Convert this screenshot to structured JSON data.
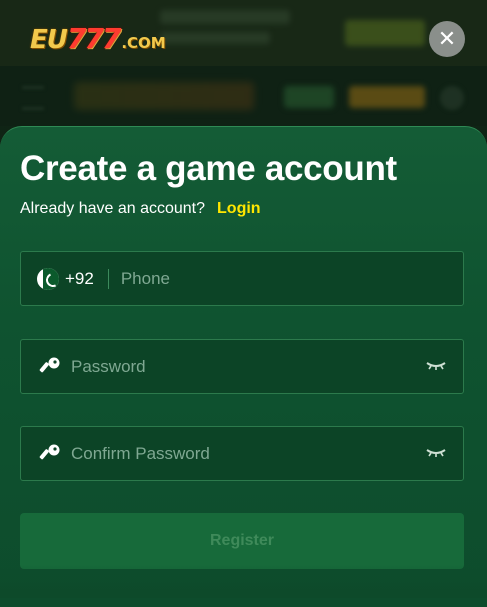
{
  "brand": {
    "logo_eu": "EU",
    "logo_num": "777",
    "logo_com": ".COM"
  },
  "header": {
    "close_symbol": "✕"
  },
  "form": {
    "title": "Create a game account",
    "have_account_text": "Already have an account?",
    "login_link": "Login",
    "phone": {
      "country_code": "+92",
      "placeholder": "Phone",
      "flag_icon": "pakistan-flag-icon"
    },
    "password": {
      "placeholder": "Password",
      "icon": "key-icon",
      "toggle_icon": "eye-closed-icon"
    },
    "confirm_password": {
      "placeholder": "Confirm Password",
      "icon": "key-icon",
      "toggle_icon": "eye-closed-icon"
    },
    "register_label": "Register"
  },
  "colors": {
    "accent_link": "#ffe600",
    "sheet_bg": "#0f5330",
    "field_border": "#2c7a4c"
  }
}
